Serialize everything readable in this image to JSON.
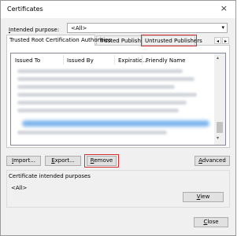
{
  "window": {
    "title": "Certificates",
    "close_glyph": "×"
  },
  "purpose": {
    "label_prefix": "I",
    "label_rest": "ntended purpose:",
    "value": "<All>",
    "arrow": "▾"
  },
  "tabs": [
    {
      "label": "Trusted Root Certification Authorities",
      "active": true
    },
    {
      "label": "Trusted Publishers",
      "active": false
    },
    {
      "label": "Untrusted Publishers",
      "active": false,
      "highlighted": true
    }
  ],
  "tab_scroll": {
    "left": "◂",
    "right": "▸"
  },
  "list": {
    "columns": [
      "Issued To",
      "Issued By",
      "Expiratio...",
      "Friendly Name"
    ],
    "scroll_up": "▴",
    "scroll_down": "▾"
  },
  "buttons": {
    "import": {
      "prefix": "I",
      "rest": "mport..."
    },
    "export": {
      "prefix": "E",
      "rest": "xport..."
    },
    "remove": {
      "prefix": "R",
      "rest": "emove"
    },
    "advanced": {
      "prefix": "A",
      "rest": "dvanced"
    },
    "view": {
      "prefix": "V",
      "rest": "iew"
    },
    "close": {
      "prefix": "C",
      "rest": "lose"
    }
  },
  "purposes_group": {
    "label": "Certificate intended purposes",
    "value": "<All>"
  },
  "colors": {
    "highlight": "#d03030",
    "selection_blur": "#7fb6ee"
  }
}
